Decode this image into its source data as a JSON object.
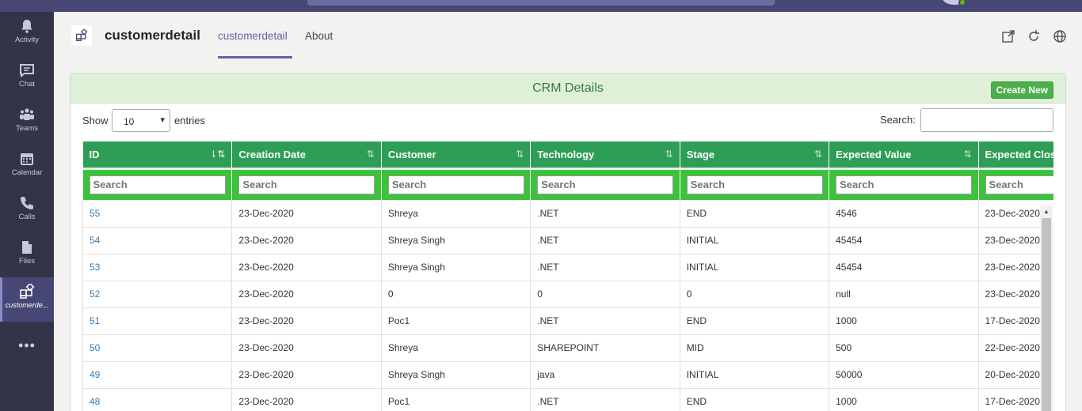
{
  "rail": {
    "items": [
      {
        "label": "Activity",
        "icon": "bell-icon"
      },
      {
        "label": "Chat",
        "icon": "chat-icon"
      },
      {
        "label": "Teams",
        "icon": "teams-icon"
      },
      {
        "label": "Calendar",
        "icon": "calendar-icon"
      },
      {
        "label": "Calls",
        "icon": "phone-icon"
      },
      {
        "label": "Files",
        "icon": "file-icon"
      },
      {
        "label": "customerde...",
        "icon": "app-icon"
      }
    ],
    "more": "•••"
  },
  "header": {
    "app_title": "customerdetail",
    "tabs": [
      {
        "label": "customerdetail",
        "active": true
      },
      {
        "label": "About",
        "active": false
      }
    ]
  },
  "panel": {
    "title": "CRM Details",
    "create_label": "Create New",
    "show_label": "Show",
    "page_length": "10",
    "entries_label": "entries",
    "search_label": "Search:"
  },
  "table": {
    "columns": [
      "ID",
      "Creation Date",
      "Customer",
      "Technology",
      "Stage",
      "Expected Value",
      "Expected Clos"
    ],
    "filter_placeholder": "Search",
    "rows": [
      [
        "55",
        "23-Dec-2020",
        "Shreya",
        ".NET",
        "END",
        "4546",
        "23-Dec-2020"
      ],
      [
        "54",
        "23-Dec-2020",
        "Shreya Singh",
        ".NET",
        "INITIAL",
        "45454",
        "23-Dec-2020"
      ],
      [
        "53",
        "23-Dec-2020",
        "Shreya Singh",
        ".NET",
        "INITIAL",
        "45454",
        "23-Dec-2020"
      ],
      [
        "52",
        "23-Dec-2020",
        "0",
        "0",
        "0",
        "null",
        "23-Dec-2020"
      ],
      [
        "51",
        "23-Dec-2020",
        "Poc1",
        ".NET",
        "END",
        "1000",
        "17-Dec-2020"
      ],
      [
        "50",
        "23-Dec-2020",
        "Shreya",
        "SHAREPOINT",
        "MID",
        "500",
        "22-Dec-2020"
      ],
      [
        "49",
        "23-Dec-2020",
        "Shreya Singh",
        "java",
        "INITIAL",
        "50000",
        "20-Dec-2020"
      ],
      [
        "48",
        "23-Dec-2020",
        "Poc1",
        ".NET",
        "END",
        "1000",
        "17-Dec-2020"
      ]
    ]
  },
  "colors": {
    "rail_bg": "#33344a",
    "accent": "#6264a7",
    "header_green": "#2e9e57",
    "filter_green": "#3cc33c",
    "panel_head": "#dff0d8"
  }
}
